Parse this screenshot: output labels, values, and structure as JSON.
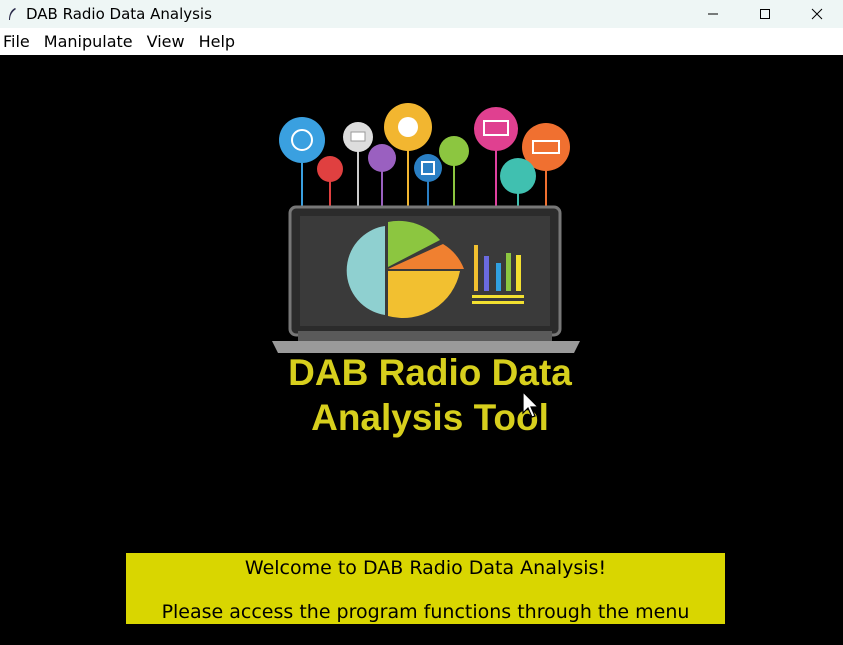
{
  "window": {
    "title": "DAB Radio Data Analysis"
  },
  "menu": [
    {
      "label": "File"
    },
    {
      "label": "Manipulate"
    },
    {
      "label": "View"
    },
    {
      "label": "Help"
    }
  ],
  "logo": {
    "title_line1": "DAB Radio Data",
    "title_line2": "Analysis Tool"
  },
  "welcome": {
    "line1": "Welcome to DAB Radio Data Analysis!",
    "line2": "Please access the program functions through the menu options above."
  },
  "colors": {
    "accent_yellow": "#d9d600",
    "title_yellow": "#d7cf1d",
    "background": "#000000"
  }
}
